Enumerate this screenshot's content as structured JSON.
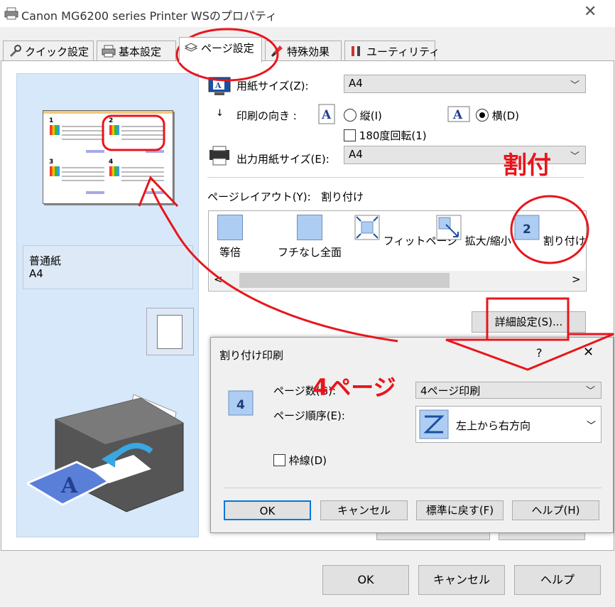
{
  "window": {
    "title": "Canon MG6200 series Printer WSのプロパティ",
    "close": "✕"
  },
  "tabs": [
    {
      "label": "クイック設定"
    },
    {
      "label": "基本設定"
    },
    {
      "label": "ページ設定"
    },
    {
      "label": "特殊効果"
    },
    {
      "label": "ユーティリティ"
    }
  ],
  "preview": {
    "page_numbers": [
      "1",
      "2",
      "3",
      "4"
    ],
    "media_type": "普通紙",
    "media_size": "A4"
  },
  "page_setup": {
    "paper_size_label": "用紙サイズ(Z):",
    "paper_size_value": "A4",
    "orientation_label": "印刷の向き :",
    "portrait_label": "縦(I)",
    "landscape_label": "横(D)",
    "rotate_label": "180度回転(1)",
    "output_size_label": "出力用紙サイズ(E):",
    "output_size_value": "A4",
    "layout_label": "ページレイアウト(Y):",
    "layout_value": "割り付け",
    "layout_items": [
      {
        "label": "等倍"
      },
      {
        "label": "フチなし全面"
      },
      {
        "label": "フィットページ"
      },
      {
        "label": "拡大/縮小"
      },
      {
        "label": "割り付け",
        "icon_text": "2"
      }
    ],
    "scroll_left": "<",
    "scroll_right": ">",
    "details_button": "詳細設定(S)..."
  },
  "dialog": {
    "title": "割り付け印刷",
    "help": "?",
    "close": "✕",
    "icon_text": "4",
    "pages_label": "ページ数(G):",
    "pages_value": "4ページ印刷",
    "order_label": "ページ順序(E):",
    "order_value": "左上から右方向",
    "border_label": "枠線(D)",
    "ok": "OK",
    "cancel": "キャンセル",
    "defaults": "標準に戻す(F)",
    "help_button": "ヘルプ(H)"
  },
  "footer": {
    "ok": "OK",
    "cancel": "キャンセル",
    "help": "ヘルプ"
  },
  "annotations": {
    "warituke": "割付",
    "four_pages": "4ページ",
    "color": "#e8151b"
  }
}
